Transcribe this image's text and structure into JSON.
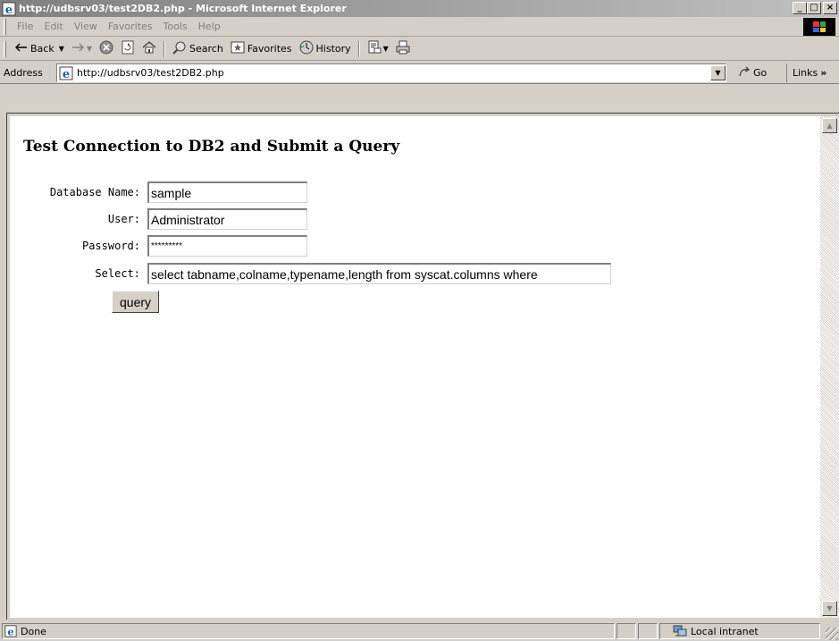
{
  "window": {
    "title": "http://udbsrv03/test2DB2.php - Microsoft Internet Explorer",
    "minimize": "_",
    "maximize": "□",
    "close": "×"
  },
  "menubar": {
    "items": [
      "File",
      "Edit",
      "View",
      "Favorites",
      "Tools",
      "Help"
    ]
  },
  "toolbar": {
    "back": "Back",
    "search": "Search",
    "favorites": "Favorites",
    "history": "History"
  },
  "address": {
    "label": "Address",
    "url": "http://udbsrv03/test2DB2.php",
    "go": "Go",
    "links": "Links"
  },
  "page": {
    "heading": "Test Connection to DB2 and Submit a Query",
    "fields": [
      {
        "label": "Database Name:",
        "value": "sample"
      },
      {
        "label": "User:",
        "value": "Administrator"
      },
      {
        "label": "Password:",
        "value": "*********"
      },
      {
        "label": "Select:",
        "value": "select tabname,colname,typename,length from syscat.columns where"
      }
    ],
    "submit": "query"
  },
  "status": {
    "text": "Done",
    "zone": "Local intranet"
  },
  "colors": {
    "titlebar": "#808080",
    "chrome": "#d4d0c8",
    "page_bg": "#ffffff"
  },
  "icons": [
    "ie-page-icon",
    "windows-flag-icon",
    "back-arrow-icon",
    "forward-arrow-icon",
    "stop-icon",
    "refresh-icon",
    "home-icon",
    "search-icon",
    "favorites-icon",
    "history-icon",
    "mail-icon",
    "print-icon",
    "go-arrow-icon",
    "intranet-icon"
  ]
}
